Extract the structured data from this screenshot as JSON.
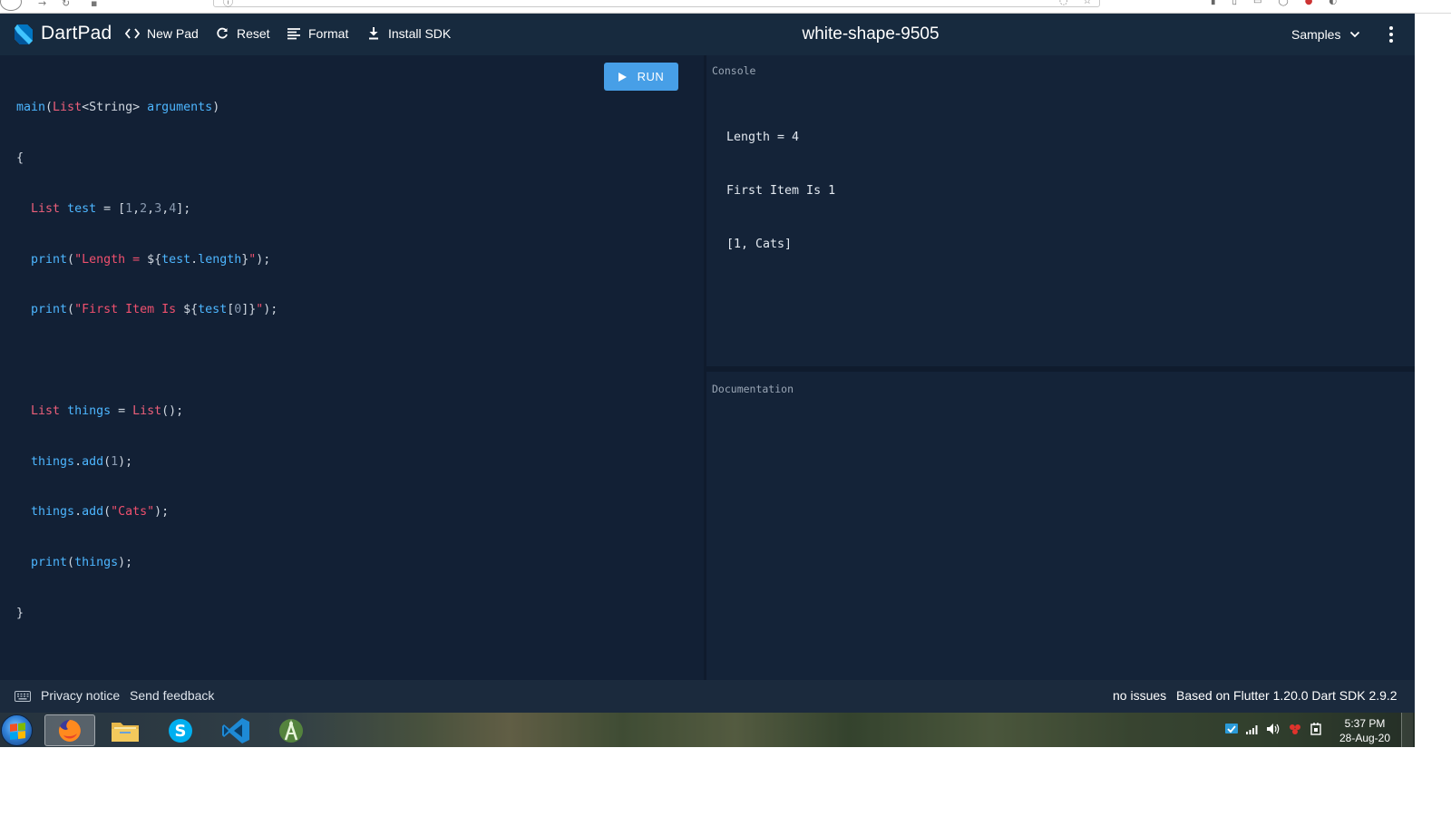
{
  "header": {
    "brand": "DartPad",
    "new_pad": "New Pad",
    "reset": "Reset",
    "format": "Format",
    "install_sdk": "Install SDK",
    "pad_title": "white-shape-9505",
    "samples": "Samples"
  },
  "editor": {
    "run_label": "RUN"
  },
  "console": {
    "label": "Console",
    "lines": [
      "Length = 4",
      "First Item Is 1",
      "[1, Cats]"
    ]
  },
  "documentation": {
    "label": "Documentation"
  },
  "footer": {
    "privacy": "Privacy notice",
    "feedback": "Send feedback",
    "issues": "no issues",
    "version": "Based on Flutter 1.20.0 Dart SDK 2.9.2"
  },
  "taskbar": {
    "time": "5:37 PM",
    "date": "28-Aug-20"
  },
  "colors": {
    "background": "#122035",
    "header": "#172a3e",
    "run_button": "#479fe7",
    "keyword": "#ec5f7a",
    "identifier": "#4db6ff",
    "string": "#f0506e"
  }
}
